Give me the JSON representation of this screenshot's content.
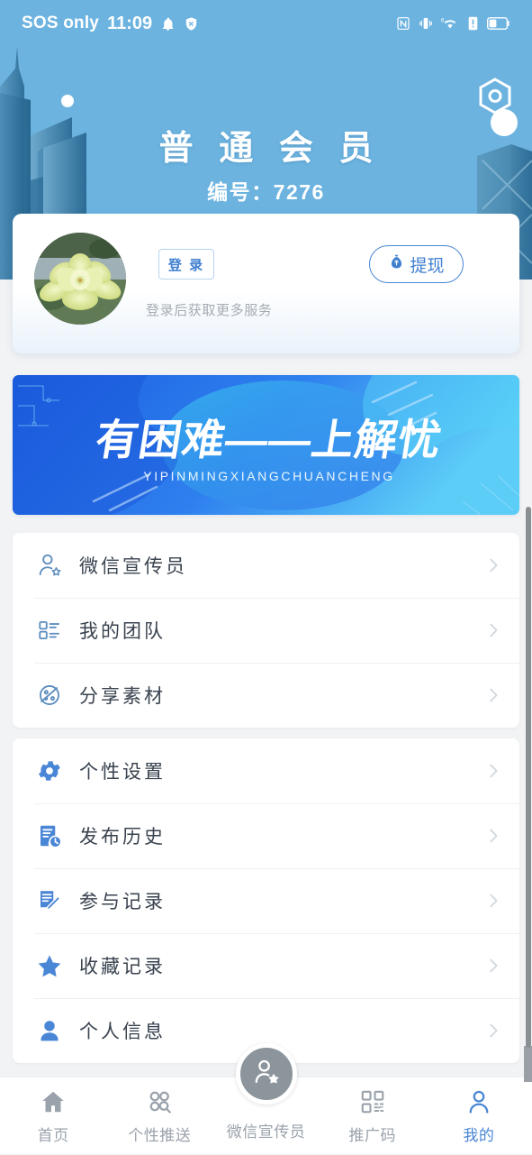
{
  "status_bar": {
    "carrier": "SOS only",
    "time": "11:09",
    "icons_left": [
      "bell-icon",
      "shield-off-icon"
    ],
    "icons_right": [
      "nfc-icon",
      "vibrate-icon",
      "wifi-6-icon",
      "sim-alert-icon",
      "battery-icon"
    ]
  },
  "hero": {
    "title": "普 通 会 员",
    "subtitle": "编号：7276",
    "background_color": "#6cb3e0",
    "decor": [
      "hexagon-outline-icon",
      "white-dot",
      "city-skyline"
    ]
  },
  "profile": {
    "avatar_alt": "lotus-flower-avatar",
    "login_label": "登 录",
    "login_hint": "登录后获取更多服务",
    "withdraw_label": "提现",
    "withdraw_icon": "money-bag-icon"
  },
  "banner": {
    "headline": "有困难——上解忧",
    "pinyin": "YIPINMINGXIANGCHUANCHENG",
    "gradient_from": "#1a5fe0",
    "gradient_to": "#4fc3f7"
  },
  "menu_groups": [
    {
      "items": [
        {
          "label": "微信宣传员",
          "icon": "person-star-outline-icon",
          "style": "outline"
        },
        {
          "label": "我的团队",
          "icon": "team-list-outline-icon",
          "style": "outline"
        },
        {
          "label": "分享素材",
          "icon": "share-planet-outline-icon",
          "style": "outline"
        }
      ]
    },
    {
      "items": [
        {
          "label": "个性设置",
          "icon": "gear-icon",
          "style": "solid"
        },
        {
          "label": "发布历史",
          "icon": "document-clock-icon",
          "style": "solid"
        },
        {
          "label": "参与记录",
          "icon": "note-pencil-icon",
          "style": "solid"
        },
        {
          "label": "收藏记录",
          "icon": "star-icon",
          "style": "solid"
        },
        {
          "label": "个人信息",
          "icon": "person-icon",
          "style": "solid"
        }
      ]
    }
  ],
  "tabbar": {
    "items": [
      {
        "label": "首页",
        "icon": "home-icon",
        "active": false
      },
      {
        "label": "个性推送",
        "icon": "circles-icon",
        "active": false
      },
      {
        "label": "微信宣传员",
        "icon": "person-star-icon",
        "active": false,
        "center": true
      },
      {
        "label": "推广码",
        "icon": "qr-code-icon",
        "active": false
      },
      {
        "label": "我的",
        "icon": "person-outline-icon",
        "active": true
      }
    ],
    "active_color": "#4a86d6",
    "inactive_color": "#9aa2ab"
  },
  "colors": {
    "header_blue": "#6cb3e0",
    "accent_blue": "#4a86d6",
    "page_bg": "#f2f3f5",
    "card_white": "#ffffff",
    "label_text": "#39434f",
    "muted_text": "#a7acb3"
  }
}
